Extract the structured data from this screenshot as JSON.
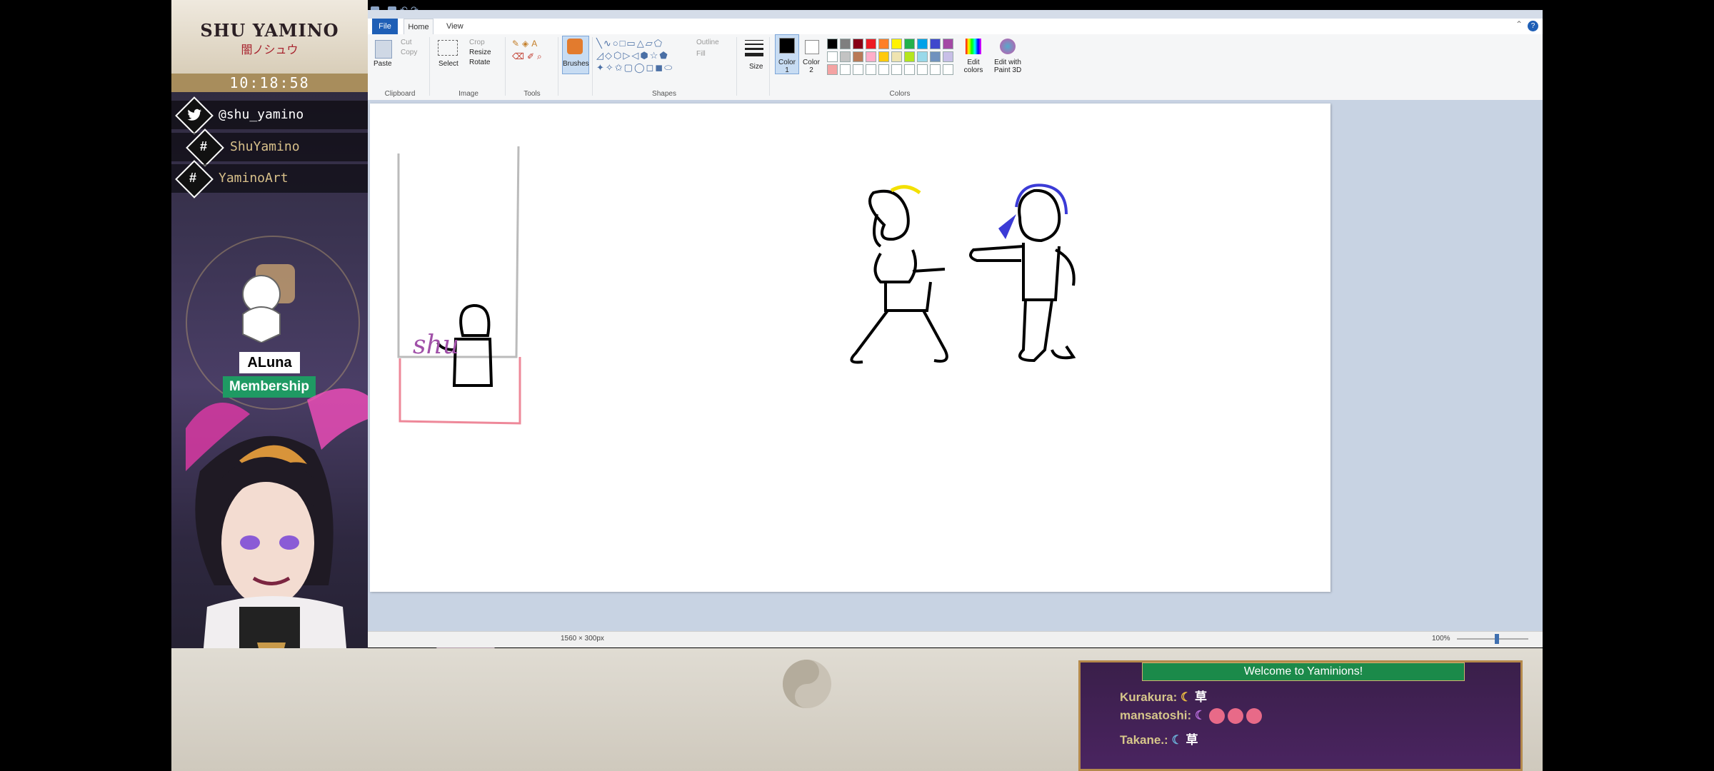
{
  "overlay": {
    "channel_name": "SHU YAMINO",
    "channel_sub": "闇ノシュウ",
    "clock": "10:18:58",
    "social": [
      {
        "icon": "twitter-icon",
        "text": "@shu_yamino"
      },
      {
        "icon": "hashtag-icon",
        "glyph": "#",
        "text": "ShuYamino"
      },
      {
        "icon": "hashtag-icon",
        "glyph": "#",
        "text": "YaminoArt"
      }
    ],
    "member_name": "ALuna",
    "member_badge": "Membership"
  },
  "paint": {
    "tabs": {
      "file": "File",
      "home": "Home",
      "view": "View"
    },
    "clipboard": {
      "paste": "Paste",
      "cut": "Cut",
      "copy": "Copy",
      "label": "Clipboard"
    },
    "image": {
      "select": "Select",
      "crop": "Crop",
      "resize": "Resize",
      "rotate": "Rotate",
      "label": "Image"
    },
    "tools": {
      "label": "Tools"
    },
    "brushes": {
      "label": "Brushes"
    },
    "shapes": {
      "label": "Shapes",
      "outline": "Outline",
      "fill": "Fill"
    },
    "size": {
      "label": "Size"
    },
    "colors": {
      "color1": "Color 1",
      "color2": "Color 2",
      "edit_colors": "Edit colors",
      "edit_paint3d": "Edit with Paint 3D",
      "label": "Colors",
      "palette_row1": [
        "#000000",
        "#7f7f7f",
        "#880015",
        "#ed1c24",
        "#ff7f27",
        "#fff200",
        "#22b14c",
        "#00a2e8",
        "#3f48cc",
        "#a349a4"
      ],
      "palette_row2": [
        "#ffffff",
        "#c3c3c3",
        "#b97a57",
        "#ffaec9",
        "#ffc90e",
        "#efe4b0",
        "#b5e61d",
        "#99d9ea",
        "#7092be",
        "#c8bfe7"
      ],
      "palette_row3": [
        "#f4a3a3",
        "#ffffff",
        "#ffffff",
        "#ffffff",
        "#ffffff",
        "#ffffff",
        "#ffffff",
        "#ffffff",
        "#ffffff",
        "#ffffff"
      ]
    },
    "status": {
      "dimensions": "1560 × 300px",
      "zoom": "100%"
    }
  },
  "drawing": {
    "caption": "shu"
  },
  "chat": {
    "welcome": "Welcome to Yaminions!",
    "messages": [
      {
        "user": "Kurakura:",
        "text": "草"
      },
      {
        "user": "mansatoshi:",
        "text": ""
      },
      {
        "user": "Takane.:",
        "text": "草"
      }
    ]
  }
}
